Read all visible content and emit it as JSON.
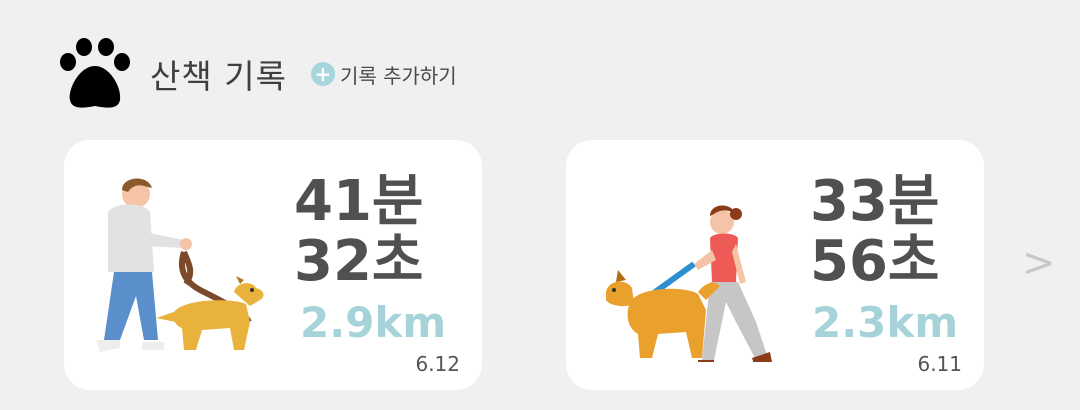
{
  "header": {
    "icon": "paw-icon",
    "title": "산책 기록",
    "add_label": "기록 추가하기",
    "add_icon": "plus-icon"
  },
  "cards": [
    {
      "minutes": "41분",
      "seconds": "32초",
      "distance": "2.9km",
      "date": "6.12",
      "illustration": "man-walking-dog"
    },
    {
      "minutes": "33분",
      "seconds": "56초",
      "distance": "2.3km",
      "date": "6.11",
      "illustration": "woman-walking-dog"
    }
  ],
  "next_arrow": ">",
  "colors": {
    "accent": "#a6d3da",
    "text_dark": "#505050",
    "card_bg": "#ffffff",
    "page_bg": "#f0f0f0"
  }
}
